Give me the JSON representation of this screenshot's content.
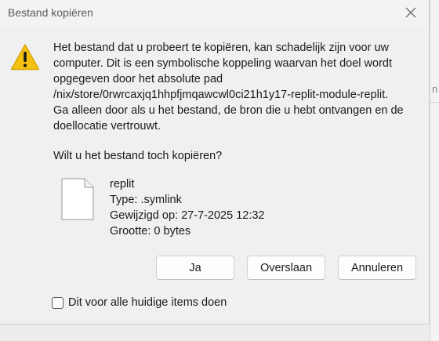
{
  "window": {
    "title": "Bestand kopiëren",
    "close_icon": "close-icon"
  },
  "background": {
    "edge_text": "n…"
  },
  "dialog": {
    "icon": "warning-icon",
    "message_lines": [
      "Het bestand dat u probeert te kopiëren, kan schadelijk zijn voor uw",
      "computer. Dit is een symbolische koppeling waarvan het doel wordt",
      "opgegeven door het absolute pad",
      "/nix/store/0rwrcaxjq1hhpfjmqawcwl0ci21h1y17-replit-module-replit.",
      "Ga alleen door als u het bestand, de bron die u hebt ontvangen en de",
      "doellocatie vertrouwt."
    ],
    "question": "Wilt u het bestand toch kopiëren?",
    "file": {
      "icon": "file-icon",
      "name": "replit",
      "type": "Type: .symlink",
      "modified": "Gewijzigd op: 27-7-2025 12:32",
      "size": "Grootte: 0 bytes"
    },
    "buttons": {
      "yes": "Ja",
      "skip": "Overslaan",
      "cancel": "Annuleren"
    },
    "checkbox": {
      "label": "Dit voor alle huidige items doen",
      "checked": false
    }
  },
  "colors": {
    "warning_yellow": "#f5c211",
    "dialog_background": "#f0f0f0",
    "button_background": "#fdfdfd"
  }
}
